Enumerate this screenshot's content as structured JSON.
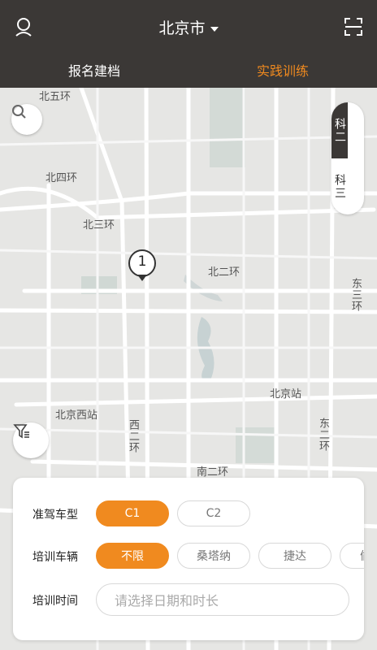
{
  "header": {
    "city": "北京市",
    "tabs": [
      {
        "label": "报名建档",
        "active": false
      },
      {
        "label": "实践训练",
        "active": true
      }
    ],
    "accent_color": "#f08a1f",
    "bg_color": "#3b3836"
  },
  "map": {
    "labels": {
      "ring5": "北五环",
      "ring4": "北四环",
      "ring3": "北三环",
      "ring2": "北二环",
      "east3": "东三环",
      "east2": "东二环",
      "west2": "西二环",
      "south2": "南二环",
      "beijing_station": "北京站",
      "beijing_west": "北京西站",
      "xi": "西"
    },
    "marker_count": "1",
    "subject_switch": [
      {
        "label": "科二",
        "active": true
      },
      {
        "label": "科三",
        "active": false
      }
    ]
  },
  "panel": {
    "license_label": "准驾车型",
    "license_options": [
      {
        "label": "C1",
        "selected": true
      },
      {
        "label": "C2",
        "selected": false
      }
    ],
    "vehicle_label": "培训车辆",
    "vehicle_options": [
      {
        "label": "不限",
        "selected": true
      },
      {
        "label": "桑塔纳",
        "selected": false
      },
      {
        "label": "捷达",
        "selected": false
      },
      {
        "label": "偷",
        "selected": false
      }
    ],
    "time_label": "培训时间",
    "time_placeholder": "请选择日期和时长"
  }
}
